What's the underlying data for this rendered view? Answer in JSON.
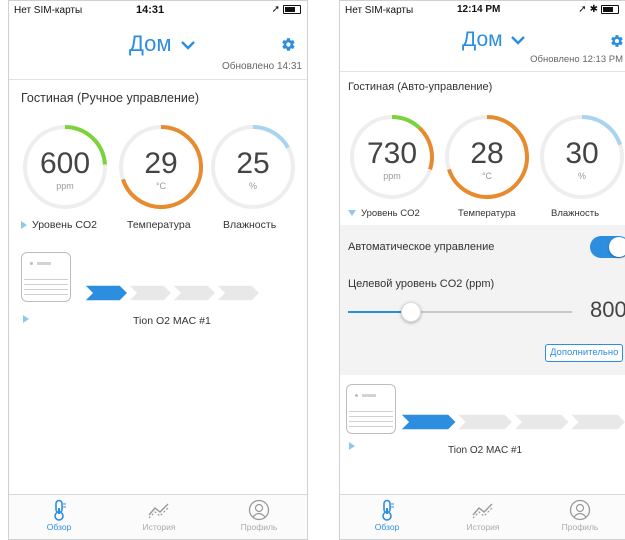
{
  "colors": {
    "accent": "#2d8ddf",
    "green": "#7bd23b",
    "orange": "#e88a2e",
    "light_blue": "#a9d4f0"
  },
  "screen1": {
    "status": {
      "carrier": "Нет SIM-карты",
      "time": "14:31"
    },
    "home_title": "Дом",
    "updated": "Обновлено 14:31",
    "room": "Гостиная  (Ручное управление)",
    "gauges": [
      {
        "value": "600",
        "unit": "ppm",
        "label": "Уровень CO2",
        "color": "#7bd23b",
        "fill": 0.24
      },
      {
        "value": "29",
        "unit": "°C",
        "label": "Температура",
        "color": "#e88a2e",
        "fill": 0.7
      },
      {
        "value": "25",
        "unit": "%",
        "label": "Влажность",
        "color": "#a9d4f0",
        "fill": 0.17
      }
    ],
    "device": {
      "name": "Tion O2 MAC #1",
      "speed": 1,
      "speed_max": 4
    },
    "tabs": [
      {
        "label": "Обзор",
        "icon": "thermometer-icon"
      },
      {
        "label": "История",
        "icon": "chart-icon"
      },
      {
        "label": "Профиль",
        "icon": "profile-icon"
      }
    ]
  },
  "screen2": {
    "status": {
      "carrier": "Нет SIM-карты",
      "time": "12:14 PM"
    },
    "home_title": "Дом",
    "updated": "Обновлено 12:13 PM",
    "room": "Гостиная (Авто-управление)",
    "gauges": [
      {
        "value": "730",
        "unit": "ppm",
        "label": "Уровень CO2",
        "color": "#e88a2e",
        "fill": 0.3
      },
      {
        "value": "28",
        "unit": "°C",
        "label": "Температура",
        "color": "#e88a2e",
        "fill": 0.7
      },
      {
        "value": "30",
        "unit": "%",
        "label": "Влажность",
        "color": "#a9d4f0",
        "fill": 0.2
      }
    ],
    "auto_control_label": "Автоматическое управление",
    "auto_control_on": true,
    "target_label": "Целевой уровень CO2 (ppm)",
    "target_value": "800",
    "target_fraction": 0.28,
    "more_button": "Дополнительно",
    "device": {
      "name": "Tion O2 MAC #1",
      "speed": 1,
      "speed_max": 4
    },
    "tabs": [
      {
        "label": "Обзор",
        "icon": "thermometer-icon"
      },
      {
        "label": "История",
        "icon": "chart-icon"
      },
      {
        "label": "Профиль",
        "icon": "profile-icon"
      }
    ]
  }
}
